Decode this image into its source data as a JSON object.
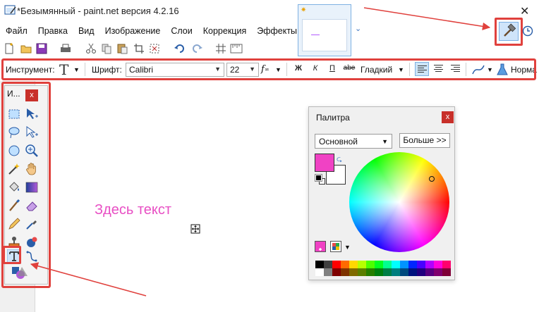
{
  "window": {
    "title": "*Безымянный - paint.net версия 4.2.16",
    "close_glyph": "✕"
  },
  "menu": {
    "items": [
      "Файл",
      "Правка",
      "Вид",
      "Изображение",
      "Слои",
      "Коррекция",
      "Эффекты"
    ]
  },
  "toolbar": {
    "icons": [
      "new-icon",
      "open-icon",
      "save-icon",
      "print-icon",
      "cut-icon",
      "copy-icon",
      "paste-icon",
      "crop-icon",
      "deselect-icon",
      "undo-icon",
      "redo-icon",
      "grid-icon",
      "ruler-icon"
    ]
  },
  "tool_options": {
    "tool_label": "Инструмент:",
    "tool_glyph": "T",
    "font_label": "Шрифт:",
    "font_value": "Calibri",
    "size_value": "22",
    "bold": "Ж",
    "italic": "К",
    "underline": "П",
    "strike": "abe",
    "smoothing_value": "Гладкий",
    "blend_label": "Норма"
  },
  "tools_panel": {
    "title": "И...",
    "close_glyph": "x",
    "selected_tool": "text-tool"
  },
  "canvas": {
    "text": "Здесь текст",
    "text_color": "#e84fc4"
  },
  "palette": {
    "title": "Палитра",
    "close_glyph": "x",
    "mode_value": "Основной",
    "more_label": "Больше >>",
    "primary_color": "#f042c4",
    "secondary_color": "#ffffff",
    "swatch_row1": [
      "#000000",
      "#404040",
      "#ff0000",
      "#ff6a00",
      "#ffd800",
      "#b6ff00",
      "#4cff00",
      "#00ff21",
      "#00ff90",
      "#00ffff",
      "#0094ff",
      "#0026ff",
      "#4800ff",
      "#b200ff",
      "#ff00dc",
      "#ff006e"
    ],
    "swatch_row2": [
      "#ffffff",
      "#808080",
      "#7f0000",
      "#7f3300",
      "#7f6a00",
      "#5b7f00",
      "#267f00",
      "#007f0e",
      "#007f46",
      "#007f7f",
      "#004a7f",
      "#00137f",
      "#21007f",
      "#57007f",
      "#7f006e",
      "#7f0037"
    ]
  },
  "annotations": {
    "highlight_color": "#e0413d"
  }
}
